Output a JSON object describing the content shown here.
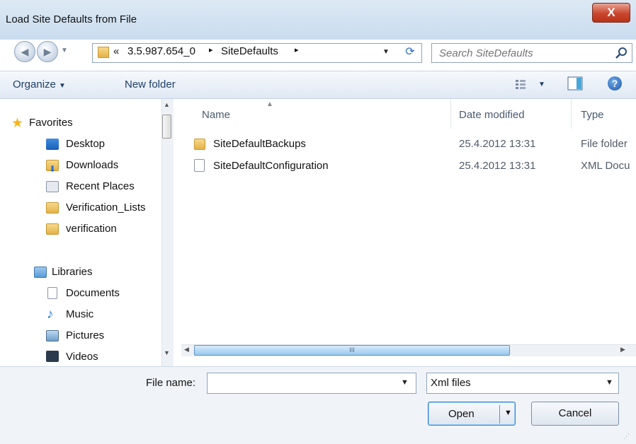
{
  "window": {
    "title": "Load Site Defaults from File",
    "close_label": "X"
  },
  "address": {
    "overflow": "«",
    "crumbs": [
      "3.5.987.654_0",
      "SiteDefaults"
    ],
    "separator": "▸",
    "refresh": "⟳"
  },
  "search": {
    "placeholder": "Search SiteDefaults"
  },
  "toolbar": {
    "organize": "Organize",
    "new_folder": "New folder",
    "help": "?"
  },
  "nav": {
    "favorites": "Favorites",
    "favorite_items": [
      "Desktop",
      "Downloads",
      "Recent Places",
      "Verification_Lists",
      "verification"
    ],
    "libraries": "Libraries",
    "library_items": [
      "Documents",
      "Music",
      "Pictures",
      "Videos"
    ]
  },
  "columns": {
    "name": "Name",
    "date": "Date modified",
    "type": "Type"
  },
  "files": [
    {
      "name": "SiteDefaultBackups",
      "date": "25.4.2012 13:31",
      "type": "File folder",
      "icon": "folder-icon"
    },
    {
      "name": "SiteDefaultConfiguration",
      "date": "25.4.2012 13:31",
      "type": "XML Docu",
      "icon": "xml-file-icon"
    }
  ],
  "scroll_grip": "III",
  "file_name": {
    "label": "File name:",
    "value": ""
  },
  "file_type": {
    "selected": "Xml files"
  },
  "buttons": {
    "open": "Open",
    "cancel": "Cancel"
  },
  "colors": {
    "accent": "#3b7bd1",
    "toolbar_text": "#1e3f6b"
  }
}
